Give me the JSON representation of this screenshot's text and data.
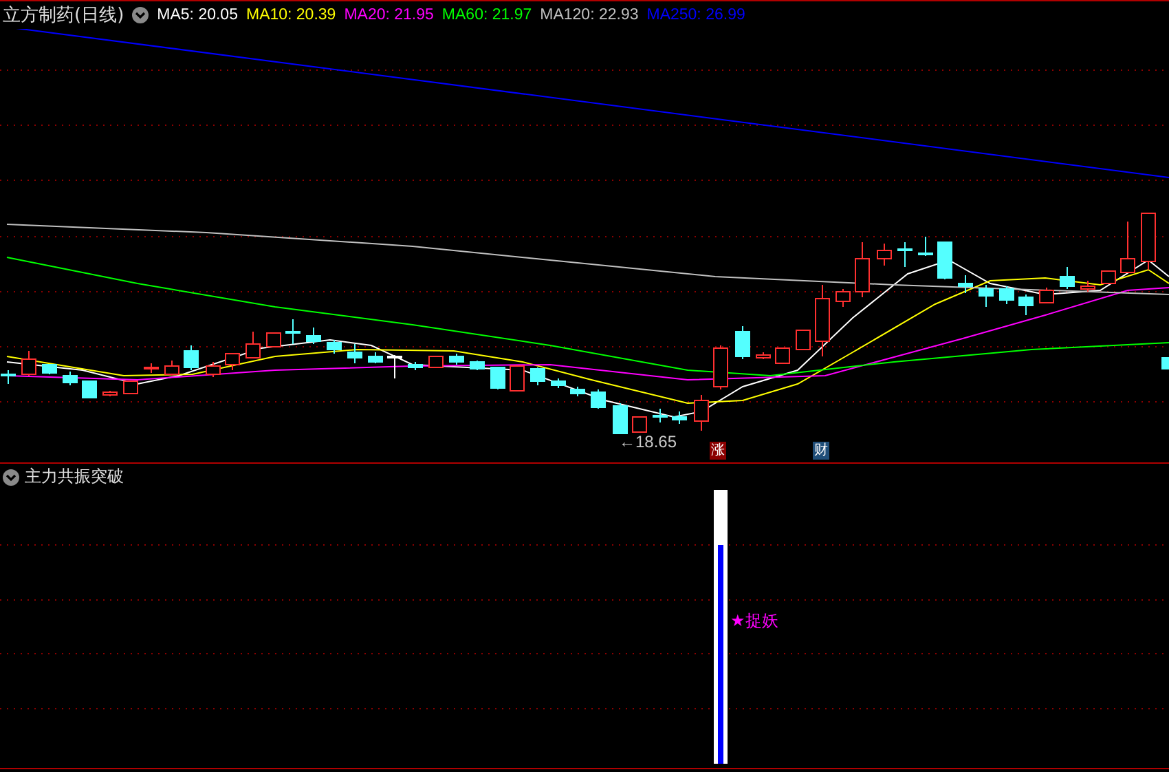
{
  "title": "立方制药(日线)",
  "moving_averages": [
    {
      "label": "MA5: 20.05",
      "color": "#ffffff"
    },
    {
      "label": "MA10: 20.39",
      "color": "#ffff00"
    },
    {
      "label": "MA20: 21.95",
      "color": "#ff00ff"
    },
    {
      "label": "MA60: 21.97",
      "color": "#00ff00"
    },
    {
      "label": "MA120: 22.93",
      "color": "#c0c0c0"
    },
    {
      "label": "MA250: 26.99",
      "color": "#0000ff"
    }
  ],
  "low_label": "←18.65",
  "event_markers": [
    {
      "text": "涨",
      "color": "#8b0000"
    },
    {
      "text": "财",
      "color": "#1f4e79"
    }
  ],
  "indicator": {
    "title": "主力共振突破",
    "signal_label": "★捉妖",
    "level": 0.8
  }
}
